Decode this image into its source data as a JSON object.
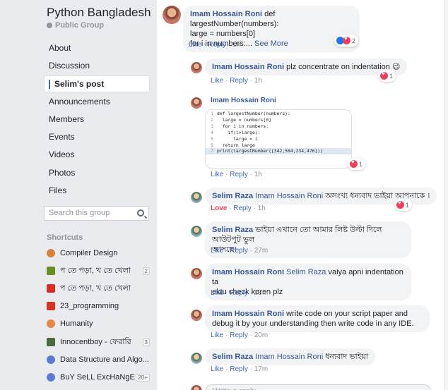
{
  "sidebar": {
    "group_name": "Python Bangladesh",
    "group_type": "Public Group",
    "nav": [
      {
        "label": "About",
        "active": false
      },
      {
        "label": "Discussion",
        "active": false
      },
      {
        "label": "Selim's post",
        "active": true
      },
      {
        "label": "Announcements",
        "active": false
      },
      {
        "label": "Members",
        "active": false
      },
      {
        "label": "Events",
        "active": false
      },
      {
        "label": "Videos",
        "active": false
      },
      {
        "label": "Photos",
        "active": false
      },
      {
        "label": "Files",
        "active": false
      }
    ],
    "search_placeholder": "Search this group",
    "shortcuts_label": "Shortcuts",
    "shortcuts": [
      {
        "label": "Compiler Design",
        "badge": "",
        "icon": "orange-circle-icon",
        "color": "#d9823b"
      },
      {
        "label": "প তে পড়া, খ তে খেলা",
        "badge": "2",
        "icon": "group-photo-icon",
        "color": "#6b8e23"
      },
      {
        "label": "প তে পড়া, খ তে খেলা",
        "badge": "",
        "icon": "dice-icon",
        "color": "#d93025"
      },
      {
        "label": "23_programming",
        "badge": "",
        "icon": "dice-icon",
        "color": "#d93025"
      },
      {
        "label": "Humanity",
        "badge": "",
        "icon": "planet-icon",
        "color": "#e8874a"
      },
      {
        "label": "Innocentboy - ফেরারি",
        "badge": "3",
        "icon": "group-photo-icon",
        "color": "#4a6b3a"
      },
      {
        "label": "Data Structure and Algo...",
        "badge": "",
        "icon": "group-icon",
        "color": "#5b7bd5"
      },
      {
        "label": "BuY SeLL ExcHaNgE",
        "badge": "20+",
        "icon": "group-icon",
        "color": "#5b7bd5"
      }
    ]
  },
  "comments": {
    "c0": {
      "author": "Imam Hossain Roni",
      "line1": "def largestNumber(numbers):",
      "line2": "large = numbers[0]",
      "line3": "for i in numbers:...",
      "see_more": "See More",
      "like": "Like",
      "reply": "Reply",
      "time": "1h",
      "reaction_count": "2"
    },
    "c1": {
      "author": "Imam Hossain Roni",
      "text": "plz concentrate on indentation 😉",
      "like": "Like",
      "reply": "Reply",
      "time": "1h",
      "reaction_count": "1"
    },
    "c2": {
      "author": "Imam Hossain Roni",
      "like": "Like",
      "reply": "Reply",
      "time": "1h",
      "reaction_count": "1",
      "code": [
        {
          "num": "1",
          "text": "def largestNumber(numbers):"
        },
        {
          "num": "2",
          "text": "  large = numbers[0]"
        },
        {
          "num": "3",
          "text": "  for i in numbers:"
        },
        {
          "num": "4",
          "text": "    if(i>large):"
        },
        {
          "num": "5",
          "text": "      large = i"
        },
        {
          "num": "6",
          "text": "  return large"
        },
        {
          "num": "7",
          "text": "print(largestNumber([342,564,234,476]))"
        }
      ]
    },
    "c3": {
      "author": "Selim Raza",
      "mention": "Imam Hossain Roni",
      "text": "অসংখ্য ধন্যবাদ ভাইয়া আপনাকে ।",
      "love": "Love",
      "reply": "Reply",
      "time": "1h",
      "reaction_count": "1"
    },
    "c4": {
      "author": "Selim Raza",
      "text1": "ভাইয়া এখানে তো আমার লিষ্ট উল্টা দিলে আউটপুট ভুল",
      "text2": "আসছে।",
      "like": "Like",
      "reply": "Reply",
      "time": "27m"
    },
    "c5": {
      "author": "Imam Hossain Roni",
      "mention": "Selim Raza",
      "text1": "vaiya apni indentation ta",
      "text2": "ektu check koren plz",
      "like": "Like",
      "reply": "Reply",
      "time": "23m"
    },
    "c6": {
      "author": "Imam Hossain Roni",
      "text1": "write code on your script paper and",
      "text2": "debug it by your understanding then write code in any IDE.",
      "like": "Like",
      "reply": "Reply",
      "time": "20m"
    },
    "c7": {
      "author": "Selim Raza",
      "mention": "Imam Hossain Roni",
      "text": "ধন্যবাদ ভাইয়া",
      "like": "Like",
      "reply": "Reply",
      "time": "17m"
    }
  },
  "reply_box": {
    "placeholder": "Write a reply..."
  }
}
